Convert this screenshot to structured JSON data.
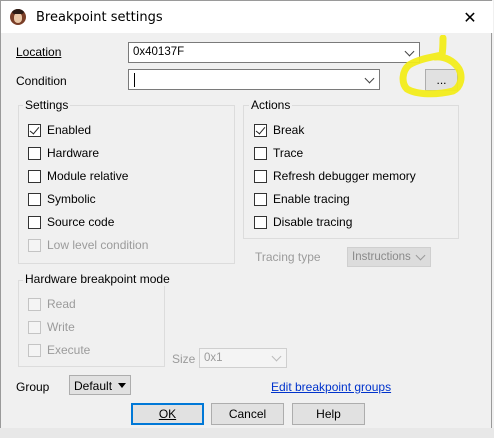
{
  "window": {
    "title": "Breakpoint settings",
    "close_glyph": "✕"
  },
  "location": {
    "label": "Location",
    "value": "0x40137F"
  },
  "condition": {
    "label": "Condition",
    "value": "",
    "ellipsis_button": "..."
  },
  "settings": {
    "title": "Settings",
    "items": [
      {
        "label": "Enabled",
        "checked": true,
        "enabled": true
      },
      {
        "label": "Hardware",
        "checked": false,
        "enabled": true
      },
      {
        "label": "Module relative",
        "checked": false,
        "enabled": true
      },
      {
        "label": "Symbolic",
        "checked": false,
        "enabled": true
      },
      {
        "label": "Source code",
        "checked": false,
        "enabled": true
      },
      {
        "label": "Low level condition",
        "checked": false,
        "enabled": false
      }
    ]
  },
  "actions": {
    "title": "Actions",
    "items": [
      {
        "label": "Break",
        "checked": true
      },
      {
        "label": "Trace",
        "checked": false
      },
      {
        "label": "Refresh debugger memory",
        "checked": false
      },
      {
        "label": "Enable tracing",
        "checked": false
      },
      {
        "label": "Disable tracing",
        "checked": false
      }
    ]
  },
  "tracing_type": {
    "label": "Tracing type",
    "value": "Instructions"
  },
  "hw_mode": {
    "title": "Hardware breakpoint mode",
    "items": [
      {
        "label": "Read",
        "checked": false,
        "enabled": false
      },
      {
        "label": "Write",
        "checked": false,
        "enabled": false
      },
      {
        "label": "Execute",
        "checked": false,
        "enabled": false
      }
    ]
  },
  "size": {
    "label": "Size",
    "value": "0x1"
  },
  "group": {
    "label": "Group",
    "value": "Default"
  },
  "edit_groups_link": "Edit breakpoint groups",
  "buttons": {
    "ok": "OK",
    "cancel": "Cancel",
    "help": "Help"
  },
  "colors": {
    "highlight": "#f2ec1a",
    "link": "#0033cc",
    "default_button_border": "#0078d7"
  }
}
